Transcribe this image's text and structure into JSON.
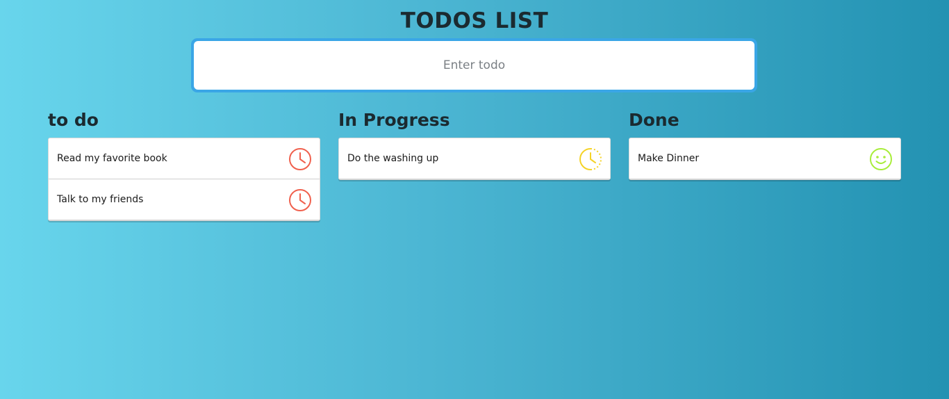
{
  "header": {
    "title": "TODOS LIST"
  },
  "input": {
    "placeholder": "Enter todo"
  },
  "columns": [
    {
      "title": "to do",
      "status": "todo",
      "icon": "clock-icon",
      "icon_color": "#f0604d",
      "items": [
        {
          "label": "Read my favorite book"
        },
        {
          "label": "Talk to my friends"
        }
      ]
    },
    {
      "title": "In Progress",
      "status": "in-progress",
      "icon": "half-clock-icon",
      "icon_color": "#f5d327",
      "items": [
        {
          "label": "Do the washing up"
        }
      ]
    },
    {
      "title": "Done",
      "status": "done",
      "icon": "smile-icon",
      "icon_color": "#a8ed3a",
      "items": [
        {
          "label": "Make Dinner"
        }
      ]
    }
  ]
}
